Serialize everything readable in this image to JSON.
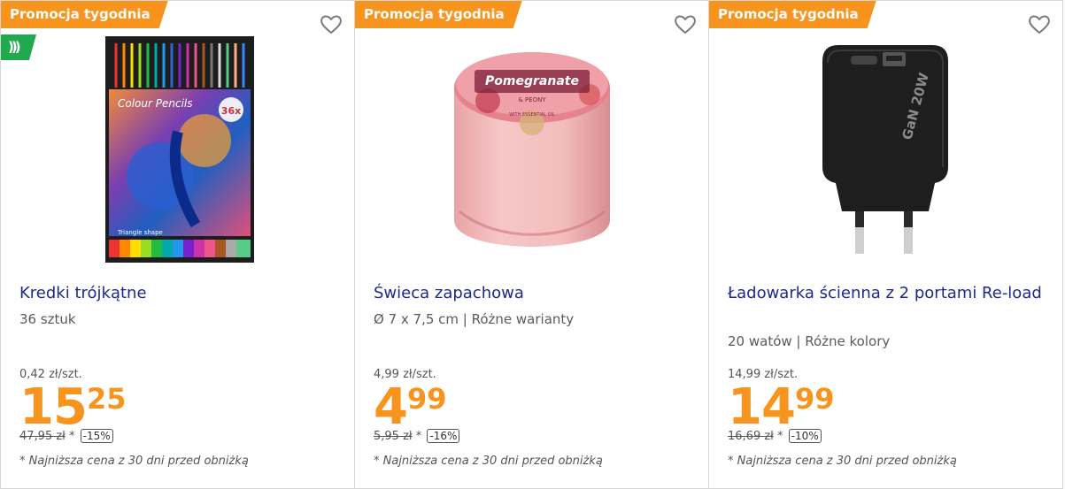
{
  "products": [
    {
      "promo_label": "Promocja tygodnia",
      "title": "Kredki trójkątne",
      "subtitle": "36 sztuk",
      "unit_price": "0,42 zł/szt.",
      "price_int": "15",
      "price_dec": "25",
      "old_price": "47,95 zł",
      "asterisk": "*",
      "discount": "-15%",
      "note": "* Najniższa cena z 30 dni przed obniżką",
      "image": "colour-pencils-box-image",
      "box_brand": "Colour Pencils",
      "box_count": "36x",
      "box_shape": "Triangle shape"
    },
    {
      "promo_label": "Promocja tygodnia",
      "title": "Świeca zapachowa",
      "subtitle": "Ø 7 x 7,5 cm | Różne warianty",
      "unit_price": "4,99 zł/szt.",
      "price_int": "4",
      "price_dec": "99",
      "old_price": "5,95 zł",
      "asterisk": "*",
      "discount": "-16%",
      "note": "* Najniższa cena z 30 dni przed obniżką",
      "image": "scented-candle-image",
      "label_main": "Pomegranate",
      "label_sub": "& PEONY",
      "label_small": "WITH ESSENTIAL OIL"
    },
    {
      "promo_label": "Promocja tygodnia",
      "title": "Ładowarka ścienna z 2 portami Re-load",
      "subtitle": "20 watów | Różne kolory",
      "unit_price": "14,99 zł/szt.",
      "price_int": "14",
      "price_dec": "99",
      "old_price": "16,69 zł",
      "asterisk": "*",
      "discount": "-10%",
      "note": "* Najniższa cena z 30 dni przed obniżką",
      "image": "wall-charger-image",
      "device_label": "GaN 20W"
    }
  ],
  "icons": {
    "favorite": "heart-outline-icon",
    "fast_delivery": "fast-delivery-icon"
  },
  "colors": {
    "accent": "#f7941d",
    "title": "#1b2a8c",
    "badge_green": "#21a94f"
  }
}
